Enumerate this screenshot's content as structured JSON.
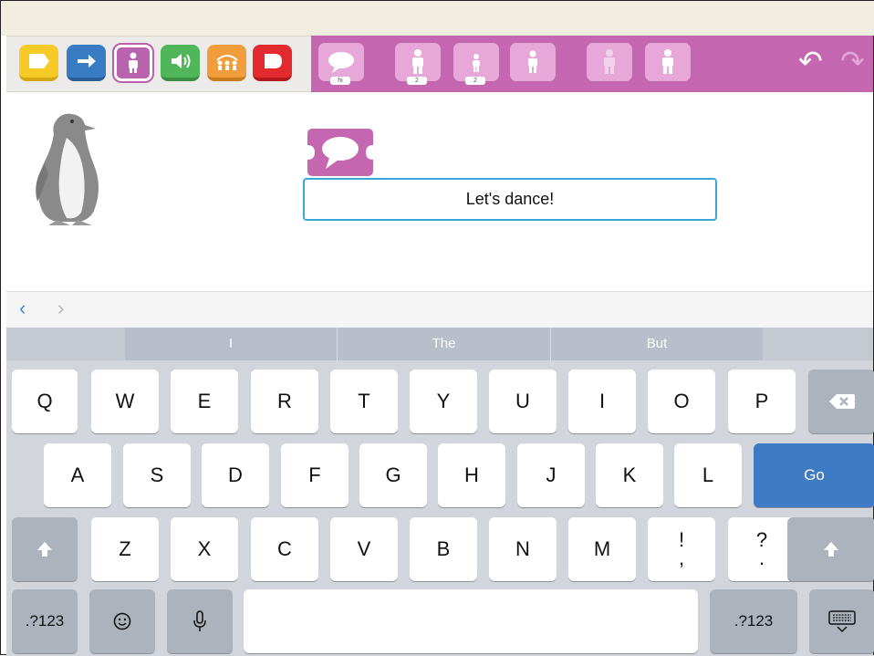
{
  "toolbar": {
    "categories": [
      {
        "name": "triggering-blocks",
        "color": "#f6cb28"
      },
      {
        "name": "motion-blocks",
        "color": "#3a7cc4"
      },
      {
        "name": "looks-blocks",
        "color": "#b962ad"
      },
      {
        "name": "sound-blocks",
        "color": "#4fb659"
      },
      {
        "name": "control-blocks",
        "color": "#f19d3c"
      },
      {
        "name": "end-blocks",
        "color": "#e22a2f"
      }
    ],
    "palette_color": "#c466b0",
    "palette_blocks": [
      {
        "name": "say-block",
        "tab": "hi"
      },
      {
        "name": "grow-block",
        "tab": "2"
      },
      {
        "name": "shrink-block",
        "tab": "2"
      },
      {
        "name": "reset-size-block",
        "tab": ""
      },
      {
        "name": "hide-block",
        "tab": ""
      },
      {
        "name": "show-block",
        "tab": ""
      }
    ],
    "undo_icon": "undo-arrow",
    "redo_icon": "redo-arrow"
  },
  "stage": {
    "character": "penguin",
    "script_block": "say-block",
    "text_value": "Let's dance!"
  },
  "nav": {
    "prev": "‹",
    "next": "›"
  },
  "keyboard": {
    "suggestions": [
      "I",
      "The",
      "But"
    ],
    "row1": [
      "Q",
      "W",
      "E",
      "R",
      "T",
      "Y",
      "U",
      "I",
      "O",
      "P"
    ],
    "row2": [
      "A",
      "S",
      "D",
      "F",
      "G",
      "H",
      "J",
      "K",
      "L"
    ],
    "go_label": "Go",
    "row3": [
      "Z",
      "X",
      "C",
      "V",
      "B",
      "N",
      "M"
    ],
    "punct1_top": "!",
    "punct1_bottom": ",",
    "punct2_top": "?",
    "punct2_bottom": ".",
    "numbers_label": ".?123",
    "accent_color": "#3f7ac5"
  }
}
